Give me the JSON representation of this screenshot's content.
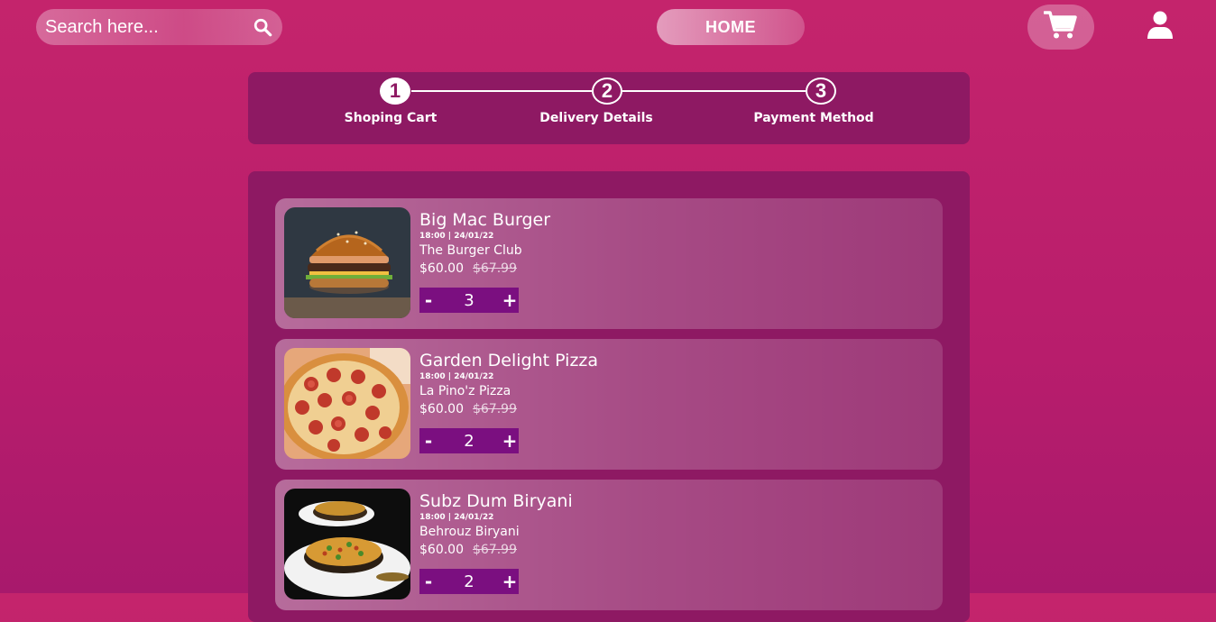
{
  "header": {
    "search_placeholder": "Search here...",
    "home_label": "HOME"
  },
  "steps": [
    {
      "number": "1",
      "label": "Shoping Cart",
      "active": true
    },
    {
      "number": "2",
      "label": "Delivery Details",
      "active": false
    },
    {
      "number": "3",
      "label": "Payment Method",
      "active": false
    }
  ],
  "cart": {
    "items": [
      {
        "name": "Big Mac Burger",
        "time": "18:00 | 24/01/22",
        "restaurant": "The Burger Club",
        "price": "$60.00",
        "old_price": "$67.99",
        "quantity": "3",
        "minus": "-",
        "plus": "+"
      },
      {
        "name": "Garden Delight Pizza",
        "time": "18:00 | 24/01/22",
        "restaurant": "La Pino'z Pizza",
        "price": "$60.00",
        "old_price": "$67.99",
        "quantity": "2",
        "minus": "-",
        "plus": "+"
      },
      {
        "name": "Subz Dum Biryani",
        "time": "18:00 | 24/01/22",
        "restaurant": "Behrouz Biryani",
        "price": "$60.00",
        "old_price": "$67.99",
        "quantity": "2",
        "minus": "-",
        "plus": "+"
      }
    ]
  },
  "colors": {
    "background": "#c4246c",
    "panel": "#8e1963",
    "stepper_bg": "#7b0f80"
  },
  "icons": {
    "search": "search-icon",
    "cart": "shopping-cart-icon",
    "user": "user-icon"
  }
}
